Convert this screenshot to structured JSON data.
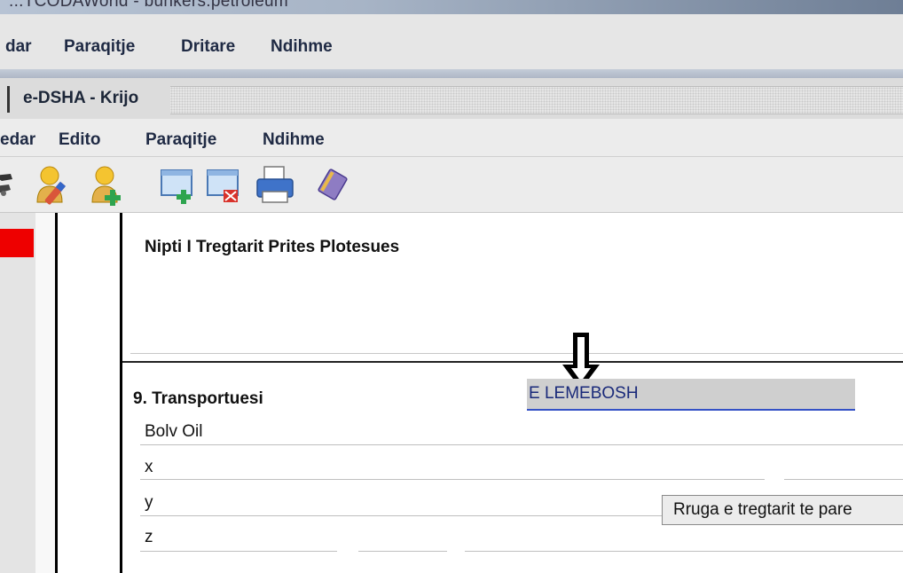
{
  "window": {
    "title": "...TCODAWorld - bunkers.petroleum"
  },
  "outer_menu": [
    "dar",
    "Paraqitje",
    "Dritare",
    "Ndihme"
  ],
  "inner_window": {
    "title": "e-DSHA - Krijo"
  },
  "inner_menu": [
    "edar",
    "Edito",
    "Paraqitje",
    "Ndihme"
  ],
  "toolbar": {
    "icons": [
      "key-icon",
      "edit-user-icon",
      "add-user-icon",
      "new-document-icon",
      "delete-document-icon",
      "print-icon",
      "notebook-icon"
    ]
  },
  "form": {
    "field_8_label": "Nipti I Tregtarit Prites Plotesues",
    "section_9_title": "9. Transportuesi",
    "highlight_value": "E LEMEBOSH",
    "transport_name": "Bolv Oil",
    "address_x": "x",
    "address_y": "y",
    "address_z": "z"
  },
  "tooltip": {
    "text": "Rruga e tregtarit te pare"
  },
  "colors": {
    "highlight_border": "#3451c6",
    "error_marker": "#ee0000"
  }
}
